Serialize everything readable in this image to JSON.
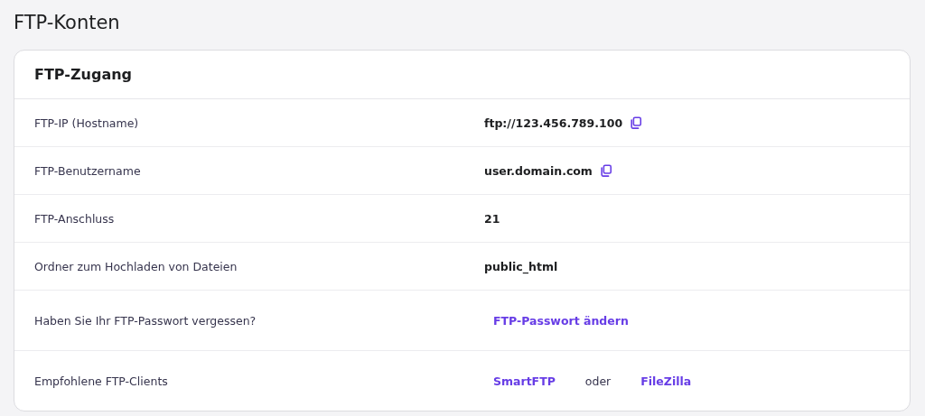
{
  "page_title": "FTP-Konten",
  "card": {
    "title": "FTP-Zugang",
    "rows": [
      {
        "kind": "value",
        "label": "FTP-IP (Hostname)",
        "value": "ftp://123.456.789.100",
        "copyable": true
      },
      {
        "kind": "value",
        "label": "FTP-Benutzername",
        "value": "user.domain.com",
        "copyable": true
      },
      {
        "kind": "value",
        "label": "FTP-Anschluss",
        "value": "21",
        "copyable": false
      },
      {
        "kind": "value",
        "label": "Ordner zum Hochladen von Dateien",
        "value": "public_html",
        "copyable": false
      },
      {
        "kind": "links",
        "label": "Haben Sie Ihr FTP-Passwort vergessen?",
        "items": [
          {
            "kind": "link",
            "text": "FTP-Passwort ändern"
          }
        ]
      },
      {
        "kind": "links",
        "label": "Empfohlene FTP-Clients",
        "items": [
          {
            "kind": "link",
            "text": "SmartFTP"
          },
          {
            "kind": "text",
            "text": "oder"
          },
          {
            "kind": "link",
            "text": "FileZilla"
          }
        ]
      }
    ]
  }
}
